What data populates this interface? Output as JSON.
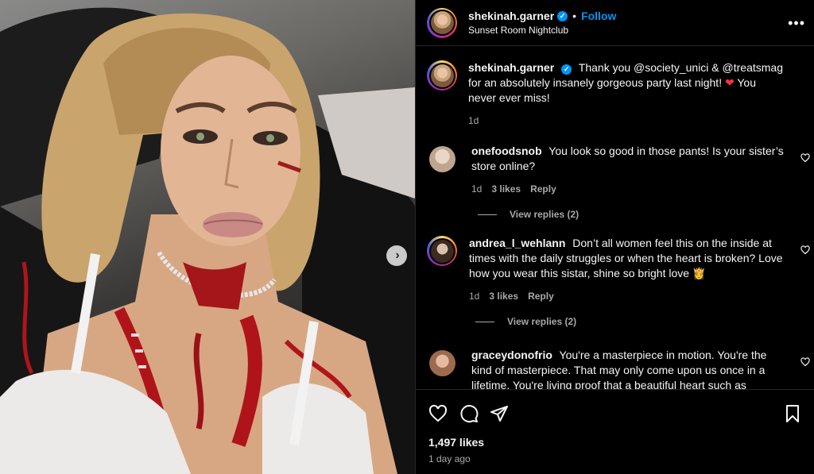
{
  "post": {
    "username": "shekinah.garner",
    "follow_label": "Follow",
    "location": "Sunset Room Nightclub",
    "more_label": "•••",
    "media_alt": "Selfie of a blonde woman in halloween blood makeup wearing a white lace top and pearl choker",
    "next_arrow": "›"
  },
  "caption": {
    "username": "shekinah.garner",
    "text_before_emoji": "Thank you @society_unici & @treatsmag for an absolutely insanely gorgeous party last night!",
    "emoji": "❤",
    "text_after_emoji": "You never ever miss!",
    "time": "1d"
  },
  "comments": [
    {
      "username": "onefoodsnob",
      "text": "You look so good in those pants! Is your sister’s store online?",
      "time": "1d",
      "likes": "3 likes",
      "reply_label": "Reply",
      "view_replies": "View replies (2)"
    },
    {
      "username": "andrea_l_wehlann",
      "text": "Don’t all women feel this on the inside at times with the daily struggles or when the heart is broken? Love how you wear this sistar, shine so bright love 👸",
      "time": "1d",
      "likes": "3 likes",
      "reply_label": "Reply",
      "view_replies": "View replies (2)"
    },
    {
      "username": "graceydonofrio",
      "text": "You're a masterpiece in motion. You're the kind of masterpiece. That may only come upon us once in a lifetime. You're living proof that a beautiful heart such as",
      "time": "",
      "likes": "",
      "reply_label": "",
      "view_replies": ""
    }
  ],
  "footer": {
    "likes": "1,497 likes",
    "time_ago": "1 day ago"
  },
  "icons": {
    "like": "heart-icon",
    "comment": "comment-icon",
    "share": "share-icon",
    "save": "bookmark-icon",
    "verified": "verified-badge-icon"
  },
  "colors": {
    "background": "#000000",
    "link_blue": "#0095f6",
    "muted_text": "#a8a8a8",
    "heart_red": "#ff3040"
  }
}
